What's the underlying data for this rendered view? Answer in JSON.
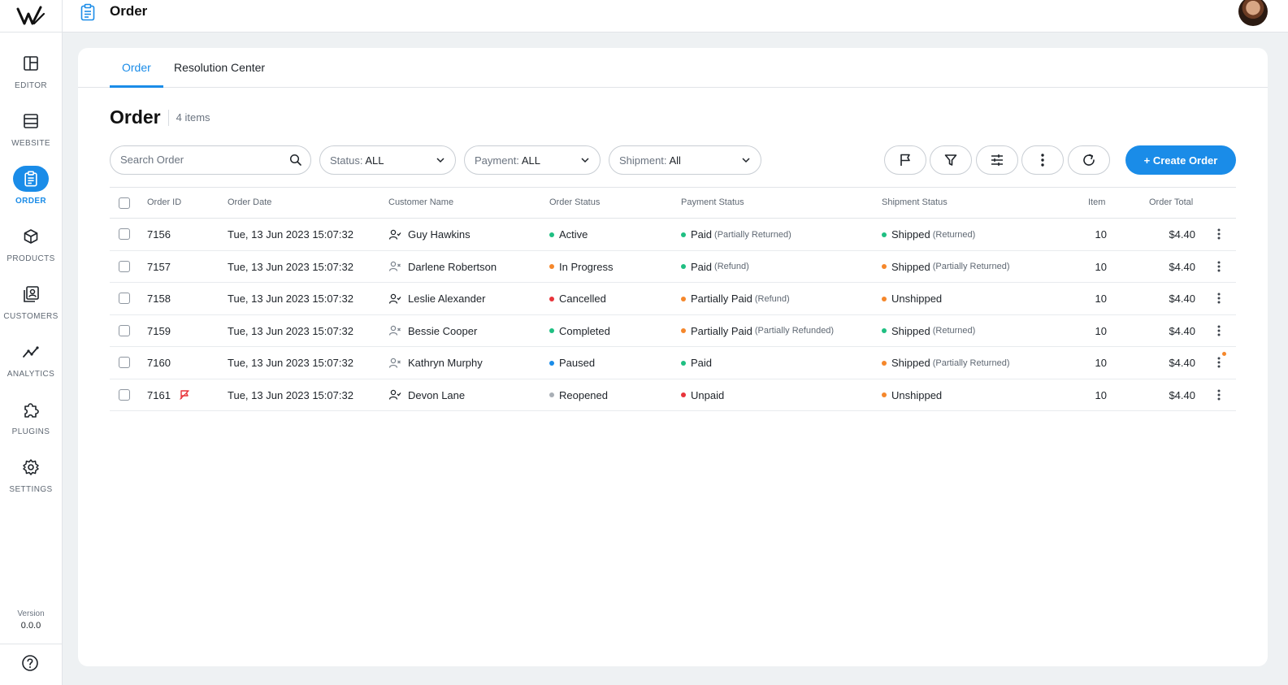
{
  "header": {
    "title": "Order"
  },
  "sidebar": {
    "items": [
      {
        "label": "EDITOR",
        "icon": "layout-icon"
      },
      {
        "label": "WEBSITE",
        "icon": "website-icon"
      },
      {
        "label": "ORDER",
        "icon": "order-icon"
      },
      {
        "label": "PRODUCTS",
        "icon": "box-icon"
      },
      {
        "label": "CUSTOMERS",
        "icon": "contacts-icon"
      },
      {
        "label": "ANALYTICS",
        "icon": "trend-icon"
      },
      {
        "label": "PLUGINS",
        "icon": "puzzle-icon"
      },
      {
        "label": "SETTINGS",
        "icon": "gear-icon"
      }
    ],
    "version_label": "Version",
    "version": "0.0.0"
  },
  "tabs": [
    {
      "label": "Order",
      "active": true
    },
    {
      "label": "Resolution Center",
      "active": false
    }
  ],
  "page": {
    "title": "Order",
    "count": "4 items"
  },
  "toolbar": {
    "search_placeholder": "Search Order",
    "status_key": "Status:",
    "status_value": "ALL",
    "payment_key": "Payment:",
    "payment_value": "ALL",
    "shipment_key": "Shipment:",
    "shipment_value": "All",
    "create_label": "+ Create Order"
  },
  "table": {
    "columns": [
      "Order ID",
      "Order Date",
      "Customer Name",
      "Order Status",
      "Payment Status",
      "Shipment Status",
      "Item",
      "Order Total"
    ],
    "rows": [
      {
        "id": "7156",
        "date": "Tue, 13 Jun 2023 15:07:32",
        "customer": "Guy Hawkins",
        "registered": true,
        "order_status": "Active",
        "order_color": "#1fbf82",
        "payment": "Paid",
        "payment_sub": "(Partially Returned)",
        "payment_color": "#1fbf82",
        "shipment": "Shipped",
        "shipment_sub": "(Returned)",
        "shipment_color": "#1fbf82",
        "items": "10",
        "total": "$4.40",
        "flag": false,
        "notif": false
      },
      {
        "id": "7157",
        "date": "Tue, 13 Jun 2023 15:07:32",
        "customer": "Darlene Robertson",
        "registered": false,
        "order_status": "In Progress",
        "order_color": "#f5872b",
        "payment": "Paid",
        "payment_sub": "(Refund)",
        "payment_color": "#1fbf82",
        "shipment": "Shipped",
        "shipment_sub": "(Partially Returned)",
        "shipment_color": "#f5872b",
        "items": "10",
        "total": "$4.40",
        "flag": false,
        "notif": false
      },
      {
        "id": "7158",
        "date": "Tue, 13 Jun 2023 15:07:32",
        "customer": "Leslie Alexander",
        "registered": true,
        "order_status": "Cancelled",
        "order_color": "#e8343a",
        "payment": "Partially Paid",
        "payment_sub": "(Refund)",
        "payment_color": "#f5872b",
        "shipment": "Unshipped",
        "shipment_sub": "",
        "shipment_color": "#f5872b",
        "items": "10",
        "total": "$4.40",
        "flag": false,
        "notif": false
      },
      {
        "id": "7159",
        "date": "Tue, 13 Jun 2023 15:07:32",
        "customer": "Bessie Cooper",
        "registered": false,
        "order_status": "Completed",
        "order_color": "#1fbf82",
        "payment": "Partially Paid",
        "payment_sub": "(Partially Refunded)",
        "payment_color": "#f5872b",
        "shipment": "Shipped",
        "shipment_sub": "(Returned)",
        "shipment_color": "#1fbf82",
        "items": "10",
        "total": "$4.40",
        "flag": false,
        "notif": false
      },
      {
        "id": "7160",
        "date": "Tue, 13 Jun 2023 15:07:32",
        "customer": "Kathryn Murphy",
        "registered": false,
        "order_status": "Paused",
        "order_color": "#1a8ce8",
        "payment": "Paid",
        "payment_sub": "",
        "payment_color": "#1fbf82",
        "shipment": "Shipped",
        "shipment_sub": "(Partially Returned)",
        "shipment_color": "#f5872b",
        "items": "10",
        "total": "$4.40",
        "flag": false,
        "notif": true
      },
      {
        "id": "7161",
        "date": "Tue, 13 Jun 2023 15:07:32",
        "customer": "Devon Lane",
        "registered": true,
        "order_status": "Reopened",
        "order_color": "#a8aeb5",
        "payment": "Unpaid",
        "payment_sub": "",
        "payment_color": "#e8343a",
        "shipment": "Unshipped",
        "shipment_sub": "",
        "shipment_color": "#f5872b",
        "items": "10",
        "total": "$4.40",
        "flag": true,
        "notif": false
      }
    ]
  },
  "colors": {
    "accent": "#1a8ce8"
  }
}
